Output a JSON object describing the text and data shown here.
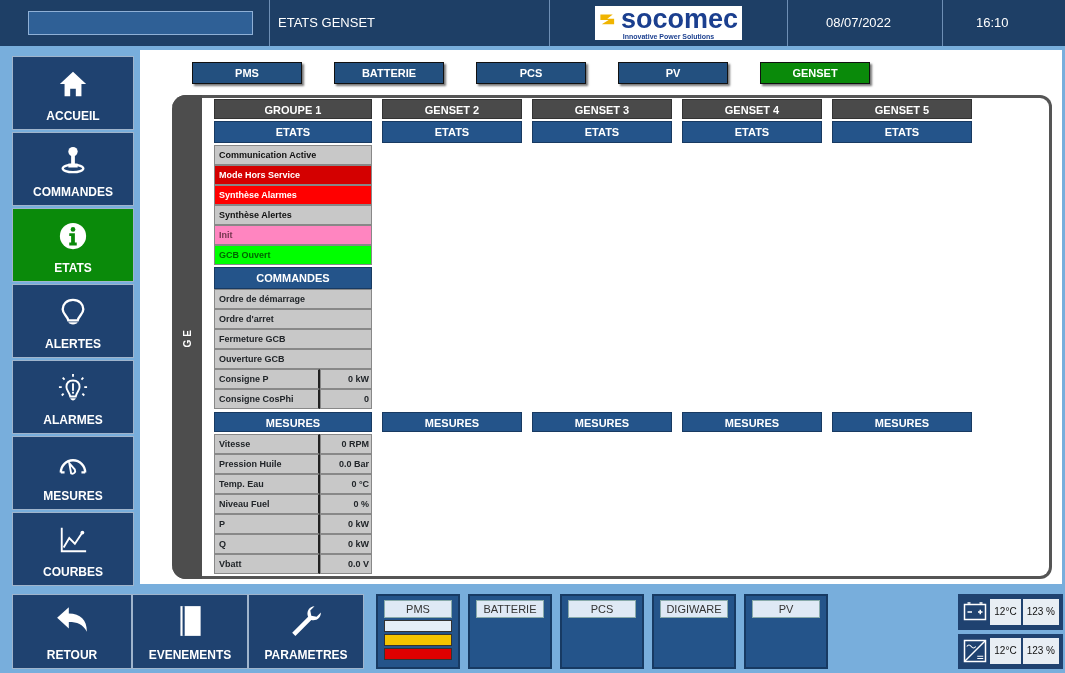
{
  "top_bar": {
    "title": "ETATS GENSET",
    "logo": {
      "name": "socomec",
      "tagline": "Innovative Power Solutions"
    },
    "date": "08/07/2022",
    "time": "16:10"
  },
  "sidebar": {
    "items": [
      {
        "label": "ACCUEIL",
        "selected": false
      },
      {
        "label": "COMMANDES",
        "selected": false
      },
      {
        "label": "ETATS",
        "selected": true
      },
      {
        "label": "ALERTES",
        "selected": false
      },
      {
        "label": "ALARMES",
        "selected": false
      },
      {
        "label": "MESURES",
        "selected": false
      },
      {
        "label": "COURBES",
        "selected": false
      }
    ]
  },
  "tabs": [
    {
      "label": "PMS",
      "selected": false
    },
    {
      "label": "BATTERIE",
      "selected": false
    },
    {
      "label": "PCS",
      "selected": false
    },
    {
      "label": "PV",
      "selected": false
    },
    {
      "label": "GENSET",
      "selected": true
    }
  ],
  "frame_label": "GE",
  "columns": [
    {
      "title": "GROUPE 1",
      "states_header": "ETATS",
      "states": [
        {
          "label": "Communication Active",
          "color": "#c8c8c8"
        },
        {
          "label": "Mode Hors Service",
          "color": "#d40000"
        },
        {
          "label": "Synthèse Alarmes",
          "color": "#ff0000"
        },
        {
          "label": "Synthèse Alertes",
          "color": "#c8c8c8"
        },
        {
          "label": "Init",
          "color": "#ff85c0"
        },
        {
          "label": "GCB Ouvert",
          "color": "#00ff00"
        }
      ],
      "commands_header": "COMMANDES",
      "commands": [
        {
          "kind": "command",
          "label": "Ordre de démarrage"
        },
        {
          "kind": "command",
          "label": "Ordre d'arret"
        },
        {
          "kind": "command",
          "label": "Fermeture GCB"
        },
        {
          "kind": "command",
          "label": "Ouverture GCB"
        },
        {
          "kind": "setpoint",
          "label": "Consigne P",
          "value": "0 kW"
        },
        {
          "kind": "setpoint",
          "label": "Consigne CosPhi",
          "value": "0"
        }
      ],
      "measures_header": "MESURES",
      "measures": [
        {
          "label": "Vitesse",
          "value": "0 RPM"
        },
        {
          "label": "Pression Huile",
          "value": "0.0 Bar"
        },
        {
          "label": "Temp. Eau",
          "value": "0 °C"
        },
        {
          "label": "Niveau Fuel",
          "value": "0 %"
        },
        {
          "label": "P",
          "value": "0 kW"
        },
        {
          "label": "Q",
          "value": "0 kW"
        },
        {
          "label": "Vbatt",
          "value": "0.0 V"
        }
      ]
    },
    {
      "title": "GENSET 2",
      "states_header": "ETATS",
      "measures_header": "MESURES"
    },
    {
      "title": "GENSET 3",
      "states_header": "ETATS",
      "measures_header": "MESURES"
    },
    {
      "title": "GENSET 4",
      "states_header": "ETATS",
      "measures_header": "MESURES"
    },
    {
      "title": "GENSET 5",
      "states_header": "ETATS",
      "measures_header": "MESURES"
    }
  ],
  "bottom_bar": {
    "buttons": [
      {
        "label": "RETOUR"
      },
      {
        "label": "EVENEMENTS"
      },
      {
        "label": "PARAMETRES"
      }
    ],
    "systems": [
      {
        "label": "PMS",
        "indicators": [
          {
            "color": "#e4eef8"
          },
          {
            "color": "#f5c400"
          },
          {
            "color": "#e00000"
          }
        ]
      },
      {
        "label": "BATTERIE"
      },
      {
        "label": "PCS"
      },
      {
        "label": "DIGIWARE"
      },
      {
        "label": "PV"
      }
    ],
    "status": [
      {
        "kind": "battery",
        "temperature": "12°C",
        "percent": "123 %"
      },
      {
        "kind": "inverter",
        "temperature": "12°C",
        "percent": "123 %"
      }
    ]
  }
}
